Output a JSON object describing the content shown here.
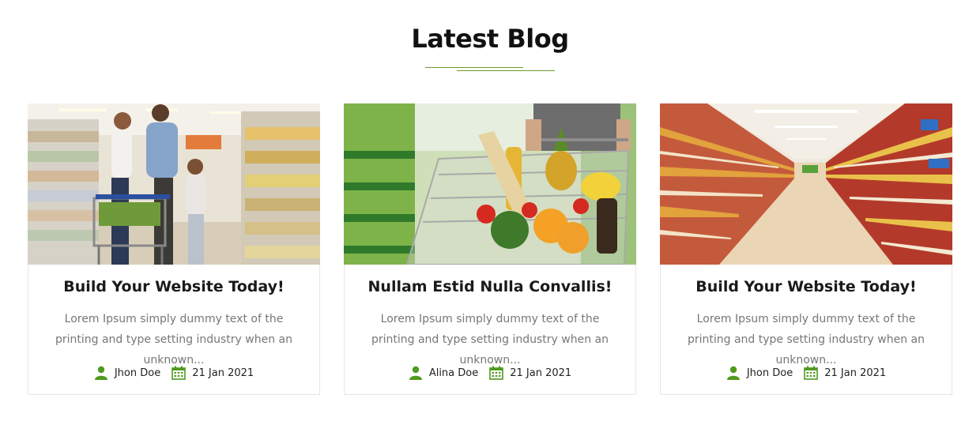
{
  "section": {
    "title": "Latest Blog"
  },
  "colors": {
    "accent": "#6a9b2a",
    "icon_green": "#4f9a1f"
  },
  "posts": [
    {
      "title": "Build Your Website Today!",
      "excerpt": "Lorem Ipsum simply dummy text of the printing and type setting industry when an unknown...",
      "author": "Jhon Doe",
      "date": "21 Jan 2021",
      "image": "family-shopping-supermarket"
    },
    {
      "title": "Nullam Estid Nulla Convallis!",
      "excerpt": "Lorem Ipsum simply dummy text of the printing and type setting industry when an unknown...",
      "author": "Alina Doe",
      "date": "21 Jan 2021",
      "image": "grocery-cart-full"
    },
    {
      "title": "Build Your Website Today!",
      "excerpt": "Lorem Ipsum simply dummy text of the printing and type setting industry when an unknown...",
      "author": "Jhon Doe",
      "date": "21 Jan 2021",
      "image": "supermarket-aisle"
    }
  ]
}
